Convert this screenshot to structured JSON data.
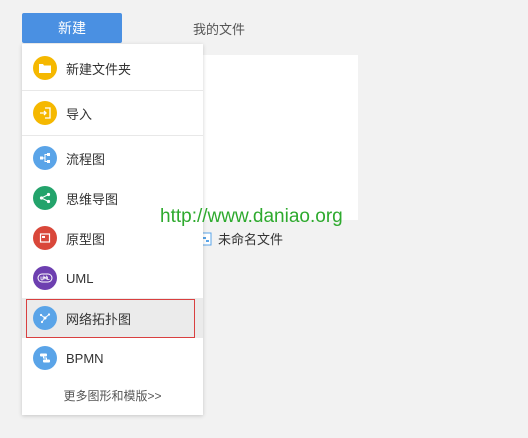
{
  "toolbar": {
    "new_label": "新建",
    "my_files_label": "我的文件"
  },
  "file_list": {
    "file_name": "未命名文件"
  },
  "watermark_text": "http://www.daniao.org",
  "menu": {
    "items": [
      {
        "label": "新建文件夹",
        "icon": "folder-icon",
        "color": "#f5b800"
      },
      {
        "label": "导入",
        "icon": "import-icon",
        "color": "#f5b800"
      },
      {
        "label": "流程图",
        "icon": "flowchart-icon",
        "color": "#5aa4e8"
      },
      {
        "label": "思维导图",
        "icon": "mindmap-icon",
        "color": "#23a36b"
      },
      {
        "label": "原型图",
        "icon": "prototype-icon",
        "color": "#d9473a"
      },
      {
        "label": "UML",
        "icon": "uml-icon",
        "color": "#6d3fb0"
      },
      {
        "label": "网络拓扑图",
        "icon": "network-topology-icon",
        "color": "#5aa4e8"
      },
      {
        "label": "BPMN",
        "icon": "bpmn-icon",
        "color": "#5aa4e8"
      }
    ],
    "more_label": "更多图形和模版>>"
  },
  "selected_item": "网络拓扑图",
  "colors": {
    "accent": "#4a90e2",
    "highlight_border": "#d94040",
    "watermark": "#2eaa2e"
  }
}
